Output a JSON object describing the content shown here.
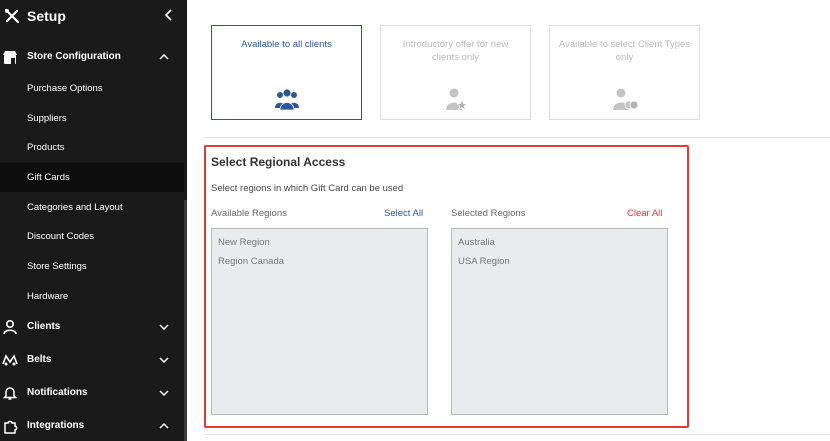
{
  "sidebar": {
    "title": "Setup",
    "sections": [
      {
        "label": "Store Configuration",
        "icon": "store-icon",
        "expanded": true
      },
      {
        "label": "Clients",
        "icon": "user-icon",
        "expanded": false
      },
      {
        "label": "Belts",
        "icon": "belts-icon",
        "expanded": false
      },
      {
        "label": "Notifications",
        "icon": "bell-icon",
        "expanded": false
      },
      {
        "label": "Integrations",
        "icon": "puzzle-icon",
        "expanded": true
      }
    ],
    "items": [
      {
        "label": "Purchase Options"
      },
      {
        "label": "Suppliers"
      },
      {
        "label": "Products"
      },
      {
        "label": "Gift Cards",
        "active": true
      },
      {
        "label": "Categories and Layout"
      },
      {
        "label": "Discount Codes"
      },
      {
        "label": "Store Settings"
      },
      {
        "label": "Hardware"
      }
    ]
  },
  "options": [
    {
      "label": "Available to all clients",
      "selected": true,
      "icon": "group-icon"
    },
    {
      "label": "Introductory offer for new clients only",
      "selected": false,
      "icon": "user-star-icon"
    },
    {
      "label": "Available to select Client Types only",
      "selected": false,
      "icon": "user-coins-icon"
    }
  ],
  "regional": {
    "title": "Select Regional Access",
    "subtitle": "Select regions in which Gift Card can be used",
    "available_label": "Available Regions",
    "select_all": "Select All",
    "selected_label": "Selected Regions",
    "clear_all": "Clear All",
    "available": [
      "New Region",
      "Region Canada"
    ],
    "selected": [
      "Australia",
      "USA Region"
    ]
  },
  "colors": {
    "accent": "#2b5797",
    "danger": "#d83a3a",
    "sidebar_bg": "#1a1a1a"
  }
}
